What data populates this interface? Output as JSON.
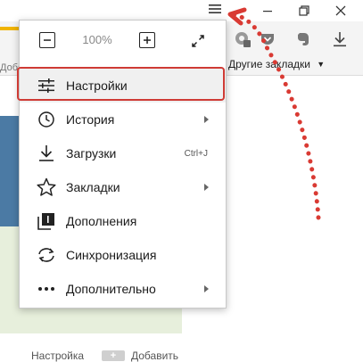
{
  "bookmarks_bar": {
    "left_fragment": "Доба",
    "other_bookmarks": "Другие закладки"
  },
  "page": {
    "footer_settings": "Настройка",
    "footer_add": "Добавить",
    "footer_plus": "+"
  },
  "menu": {
    "zoom_value": "100%",
    "items": [
      {
        "id": "settings",
        "label": "Настройки",
        "icon": "sliders-icon",
        "highlighted": true
      },
      {
        "id": "history",
        "label": "История",
        "icon": "clock-icon",
        "submenu": true
      },
      {
        "id": "downloads",
        "label": "Загрузки",
        "icon": "download-icon",
        "shortcut": "Ctrl+J"
      },
      {
        "id": "bookmarks",
        "label": "Закладки",
        "icon": "star-icon",
        "submenu": true
      },
      {
        "id": "addons",
        "label": "Дополнения",
        "icon": "extensions-icon"
      },
      {
        "id": "sync",
        "label": "Синхронизация",
        "icon": "sync-icon"
      },
      {
        "id": "more",
        "label": "Дополнительно",
        "icon": "more-dots-icon",
        "submenu": true
      }
    ]
  },
  "colors": {
    "highlight_border": "#cf3b35",
    "annotation_arrow": "#d93a33",
    "page_blue": "#4b7aa4",
    "page_green": "#e7efdc"
  }
}
